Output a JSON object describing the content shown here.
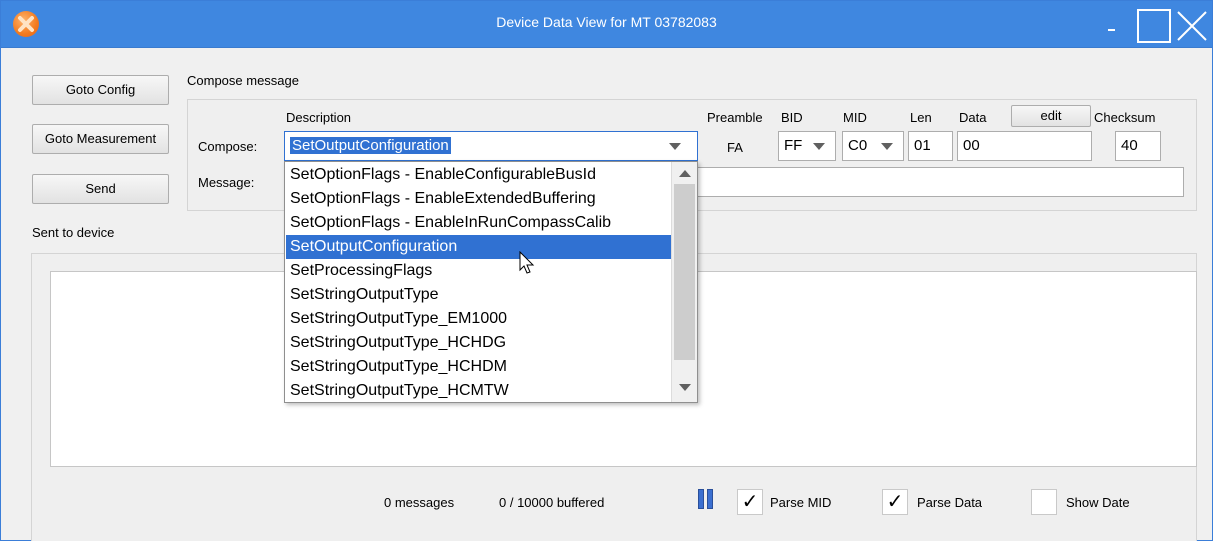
{
  "window": {
    "title": "Device Data View for MT 03782083",
    "minimize_glyph": "-"
  },
  "icons": {
    "app": "xsens-logo-icon",
    "minimize": "minimize-icon",
    "maximize": "maximize-icon",
    "close": "close-icon",
    "pause": "pause-icon",
    "cursor": "mouse-pointer-icon"
  },
  "buttons": {
    "goto_config": "Goto Config",
    "goto_measurement": "Goto Measurement",
    "send": "Send",
    "edit": "edit"
  },
  "compose": {
    "group_title": "Compose message",
    "headers": {
      "description": "Description",
      "preamble": "Preamble",
      "bid": "BID",
      "mid": "MID",
      "len": "Len",
      "data": "Data",
      "checksum": "Checksum"
    },
    "compose_label": "Compose:",
    "message_label": "Message:",
    "description_value": "SetOutputConfiguration",
    "preamble_value": "FA",
    "bid_value": "FF",
    "mid_value": "C0",
    "len_value": "01",
    "data_value": "00",
    "checksum_value": "40",
    "message_value": ""
  },
  "dropdown": {
    "items": [
      "SetOptionFlags - EnableConfigurableBusId",
      "SetOptionFlags - EnableExtendedBuffering",
      "SetOptionFlags - EnableInRunCompassCalib",
      "SetOutputConfiguration",
      "SetProcessingFlags",
      "SetStringOutputType",
      "SetStringOutputType_EM1000",
      "SetStringOutputType_HCHDG",
      "SetStringOutputType_HCHDM",
      "SetStringOutputType_HCMTW"
    ],
    "selected_index": 3
  },
  "sent": {
    "title": "Sent to device",
    "messages_count": "0 messages",
    "buffered": "0 / 10000 buffered"
  },
  "options": {
    "parse_mid": {
      "label": "Parse MID",
      "checked": true
    },
    "parse_data": {
      "label": "Parse Data",
      "checked": true
    },
    "show_date": {
      "label": "Show Date",
      "checked": false
    },
    "check_glyph": "✓"
  },
  "colors": {
    "titlebar": "#3f87e0",
    "selection": "#3071d2"
  }
}
